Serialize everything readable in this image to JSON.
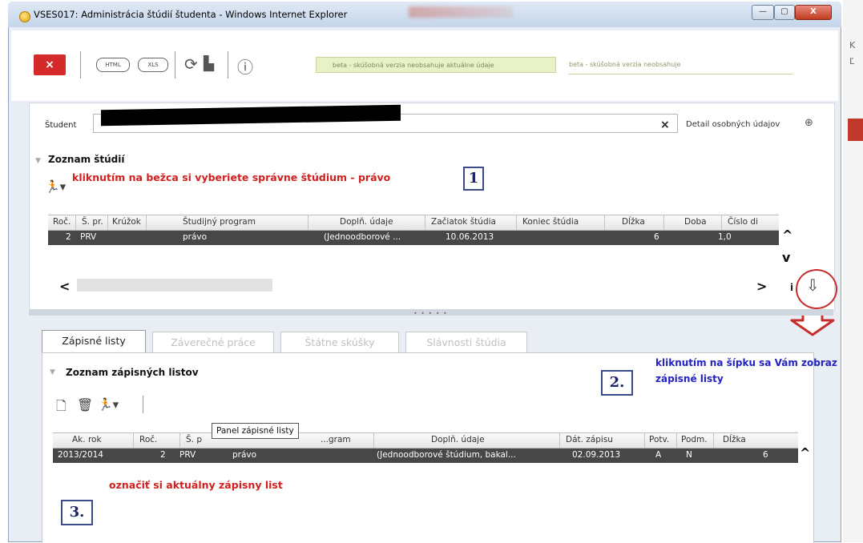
{
  "window": {
    "title": "VSES017: Administrácia štúdií študenta - Windows Internet Explorer",
    "minimize": "—",
    "maximize": "▢",
    "close": "X"
  },
  "toolbar": {
    "close_label": "×",
    "html_label": "HTML",
    "xls_label": "XLS",
    "beta_notice": "beta - skúšobná verzia neobsahuje aktuálne údaje",
    "beta_notice_2": "beta - skúšobná verzia neobsahuje"
  },
  "student": {
    "label": "Študent",
    "clear": "×",
    "detail_label": "Detail osobných údajov"
  },
  "studies": {
    "title": "Zoznam štúdií",
    "instruction": "kliknutím na bežca si vyberiete správne štúdium - právo",
    "step": "1",
    "columns": [
      "Roč.",
      "Š. pr.",
      "Krúžok",
      "Študijný program",
      "Doplň. údaje",
      "Začiatok štúdia",
      "Koniec štúdia",
      "Dĺžka",
      "Doba",
      "Číslo di"
    ],
    "row": {
      "roc": "2",
      "spr": "PRV",
      "program": "právo",
      "doplnudaje": "(Jednoodborové ...",
      "zaciatok": "10.06.2013",
      "dlzka": "6",
      "doba": "1,0"
    },
    "scroll_up": "^",
    "scroll_down": "v",
    "scroll_left": "<",
    "scroll_right": ">",
    "info": "i",
    "arrow_down": "⇩"
  },
  "tabs": [
    {
      "label": "Zápisné listy"
    },
    {
      "label": "Záverečné práce"
    },
    {
      "label": "Štátne skúšky"
    },
    {
      "label": "Slávnosti štúdia"
    }
  ],
  "enrollment": {
    "title": "Zoznam zápisných listov",
    "instruction_line1": "kliknutím na šípku sa Vám zobraz",
    "instruction_line2": "zápisné listy",
    "step2": "2.",
    "step3": "3.",
    "instruction_red": "označiť si aktuálny zápisny list",
    "tooltip": "Panel zápisné listy",
    "columns": [
      "Ak. rok",
      "Roč.",
      "Š. p",
      "...gram",
      "Doplň. údaje",
      "Dát. zápisu",
      "Potv.",
      "Podm.",
      "Dĺžka"
    ],
    "row": {
      "akrok": "2013/2014",
      "roc": "2",
      "spr": "PRV",
      "program": "právo",
      "doplnudaje": "(Jednoodborové štúdium, bakal...",
      "datum": "02.09.2013",
      "potv": "A",
      "podm": "N",
      "dlzka": "6"
    },
    "scroll_up": "^"
  },
  "bg": {
    "k1": "K",
    "k2": "Ľ"
  }
}
